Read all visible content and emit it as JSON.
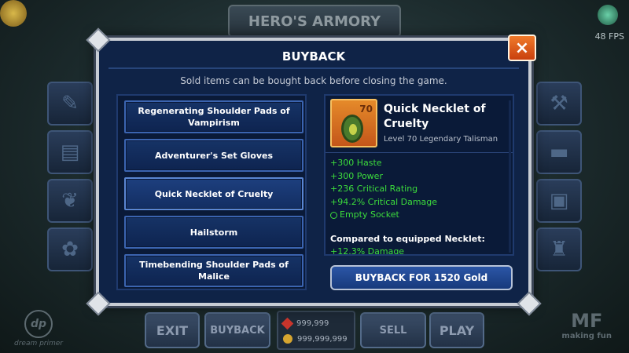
{
  "background": {
    "header_title": "HERO'S ARMORY",
    "fps": "48 FPS",
    "bottom_buttons": {
      "exit": "EXIT",
      "buyback": "BUYBACK",
      "sell": "SELL",
      "play": "PLAY"
    },
    "currency": {
      "gems": "999,999",
      "gold": "999,999,999"
    },
    "logo_left": "dream primer",
    "logo_right": "making fun",
    "logo_right_mark": "MF",
    "logo_left_mark": "dp"
  },
  "modal": {
    "title": "BUYBACK",
    "close_icon": "×",
    "subtitle": "Sold items can be bought back before closing the game.",
    "items": [
      {
        "label": "Regenerating Shoulder Pads of Vampirism"
      },
      {
        "label": "Adventurer's Set Gloves"
      },
      {
        "label": "Quick Necklet of Cruelty",
        "selected": true
      },
      {
        "label": "Hailstorm"
      },
      {
        "label": "Timebending Shoulder Pads of Malice"
      }
    ],
    "detail": {
      "level_badge": "70",
      "name": "Quick Necklet of Cruelty",
      "subtitle": "Level 70 Legendary Talisman",
      "stats": [
        "+300 Haste",
        "+300 Power",
        "+236 Critical Rating",
        "+94.2% Critical Damage"
      ],
      "socket": "Empty Socket",
      "compare_label": "Compared to equipped Necklet:",
      "compare_stat": "+12.3% Damage"
    },
    "buyback_button": "BUYBACK FOR 1520 Gold",
    "colors": {
      "stat_green": "#3cdc3c",
      "close_orange": "#e3621c",
      "panel_blue": "#0f2347"
    }
  }
}
